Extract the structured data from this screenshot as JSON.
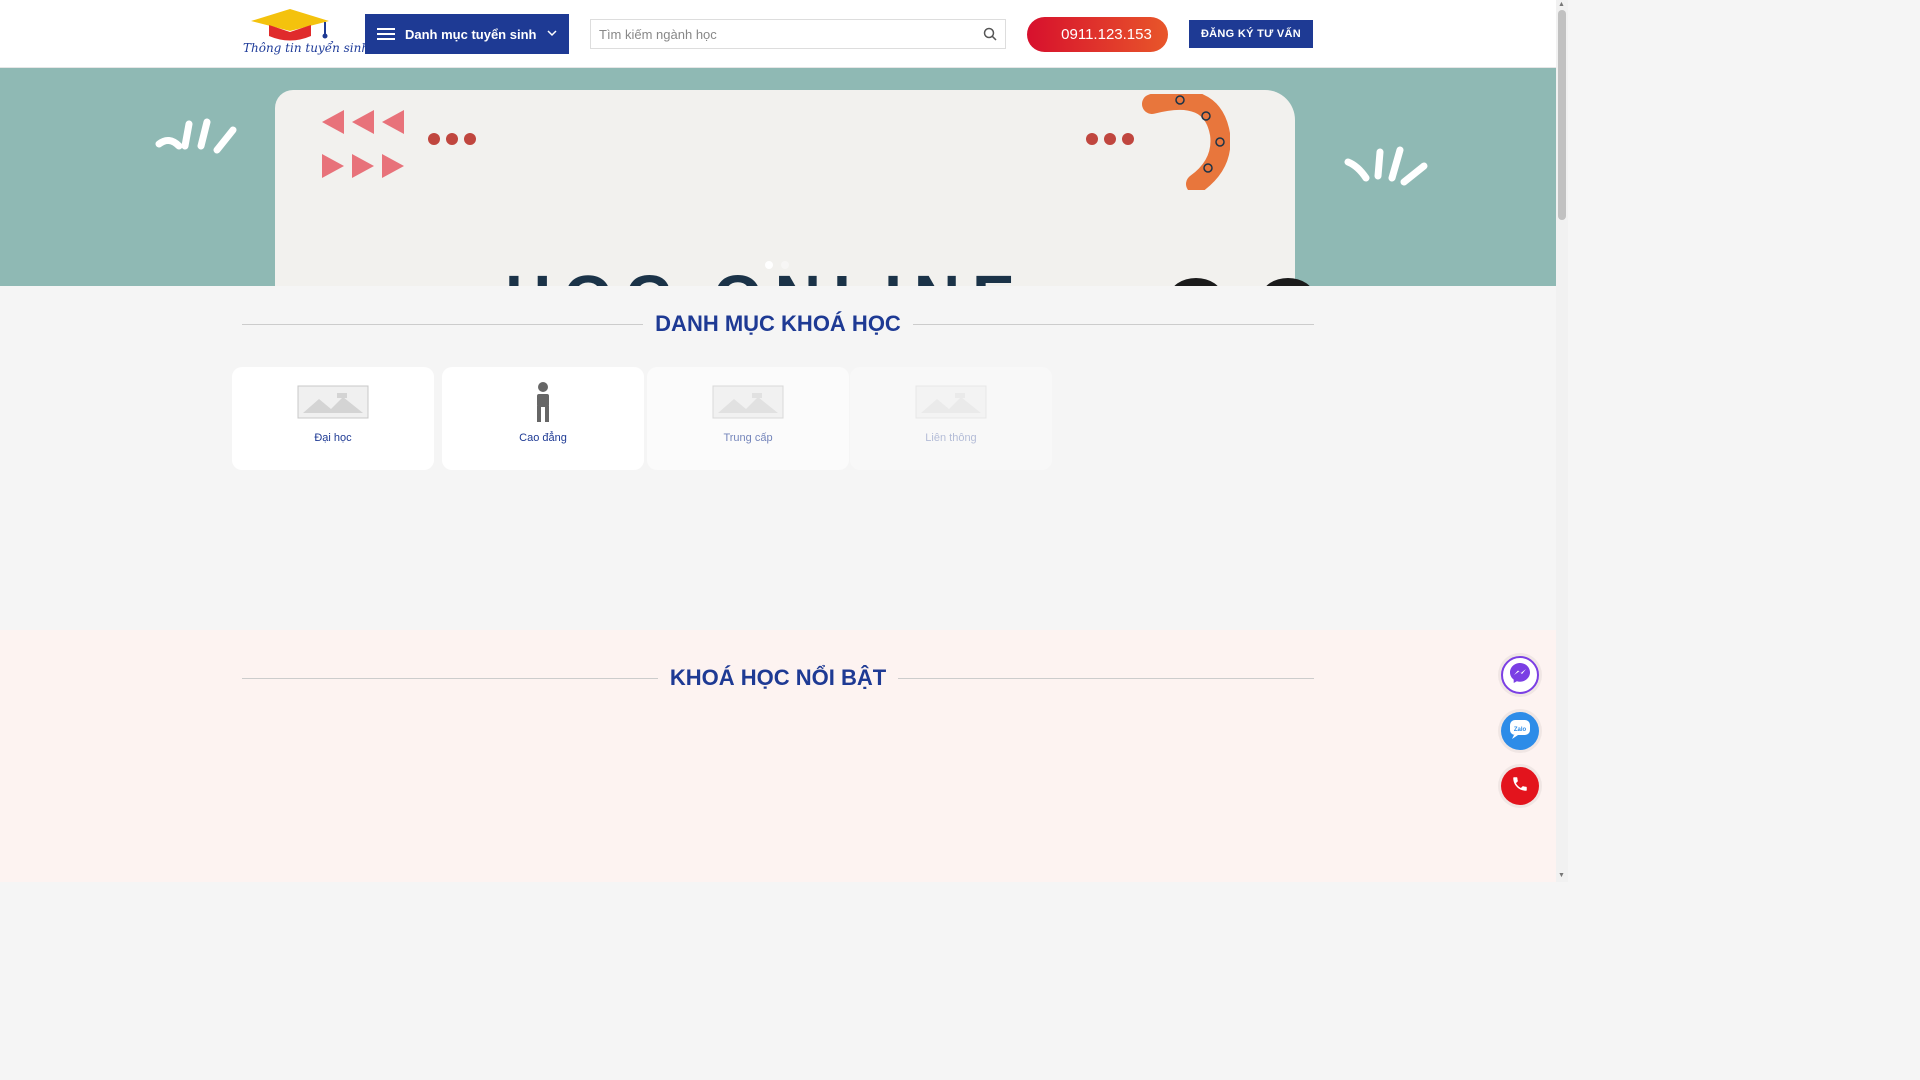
{
  "header": {
    "logo_text": "Thông tin tuyển sinh",
    "menu_label": "Danh mục tuyển sinh",
    "search_placeholder": "Tìm kiếm ngành học",
    "phone": "0911.123.153",
    "register_label": "ĐĂNG KÝ TƯ VẤN"
  },
  "banner": {
    "text": "HỌC ONLINE",
    "slide_count": 2,
    "active_slide": 1
  },
  "categories": {
    "title": "DANH MỤC KHOÁ HỌC",
    "items": [
      {
        "label": "Đại học",
        "icon": "image-placeholder-icon"
      },
      {
        "label": "Cao đẳng",
        "icon": "person-icon"
      },
      {
        "label": "Trung cấp",
        "icon": "image-placeholder-icon"
      },
      {
        "label": "Liên thông",
        "icon": "image-placeholder-icon"
      }
    ]
  },
  "featured": {
    "title": "KHOÁ HỌC NỔI BẬT"
  },
  "floating": {
    "messenger_icon": "messenger-icon",
    "zalo_icon": "zalo-icon",
    "phone_icon": "phone-icon"
  },
  "colors": {
    "brand_blue": "#1e3a94",
    "accent_red": "#d7102d",
    "banner_bg": "#8fb9b4",
    "messenger_purple": "#7b3fe4",
    "zalo_blue": "#2d8ce8",
    "call_red": "#e3141d"
  }
}
